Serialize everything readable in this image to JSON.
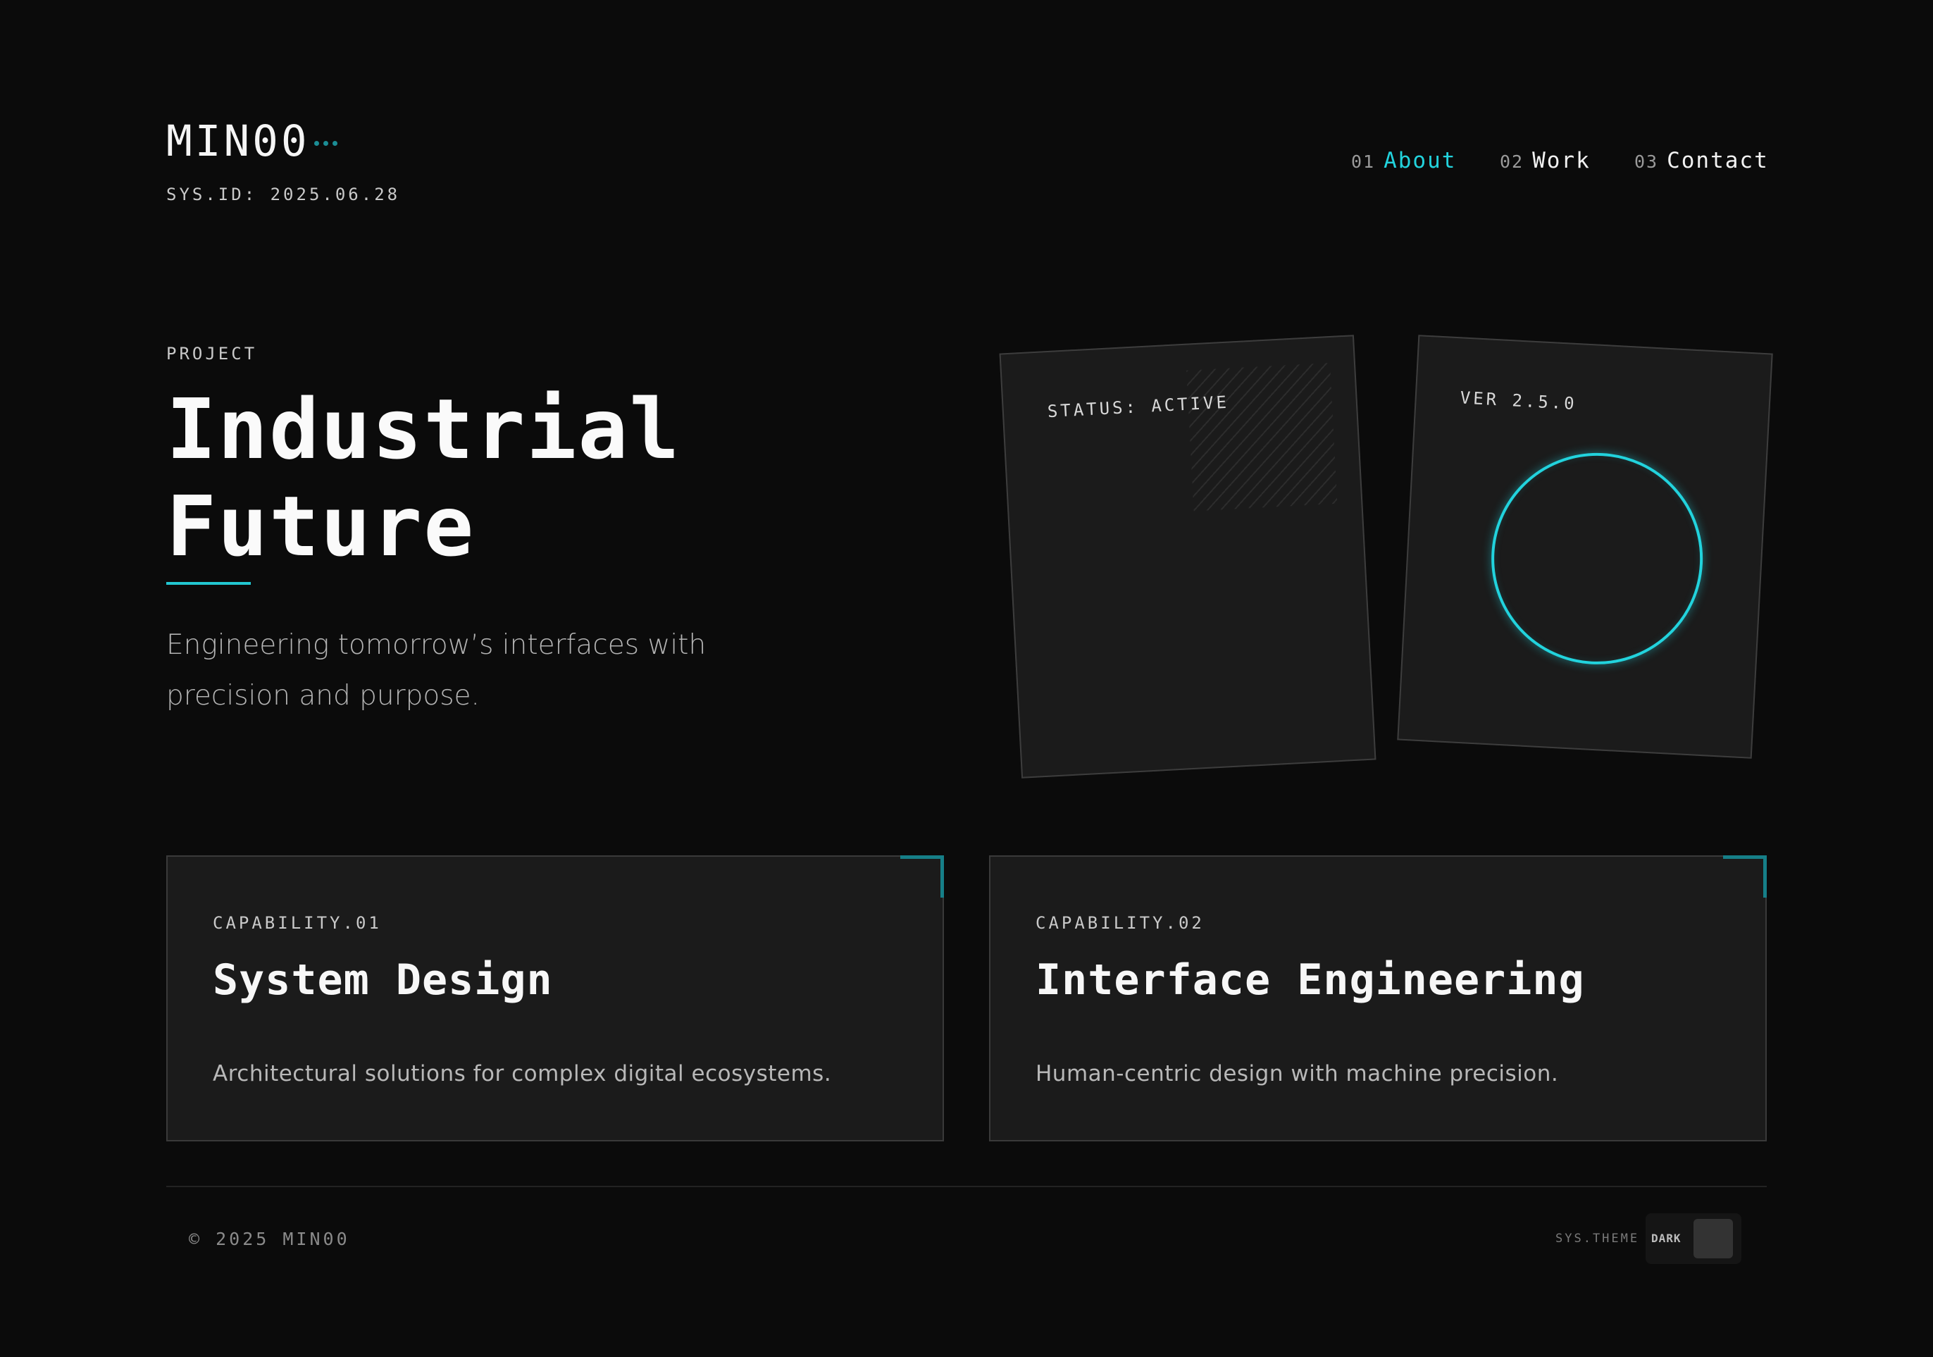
{
  "brand": {
    "logo": "MIN00",
    "sys_id": "SYS.ID: 2025.06.28"
  },
  "nav": [
    {
      "num": "01",
      "label": "About",
      "active": true
    },
    {
      "num": "02",
      "label": "Work",
      "active": false
    },
    {
      "num": "03",
      "label": "Contact",
      "active": false
    }
  ],
  "hero": {
    "eyebrow": "PROJECT",
    "title_line1": "Industrial",
    "title_line2": "Future",
    "subtitle_line1": "Engineering tomorrow’s interfaces with",
    "subtitle_line2": "precision and purpose."
  },
  "tiles": {
    "status_label": "STATUS: ACTIVE",
    "version_label": "VER 2.5.0"
  },
  "capabilities": [
    {
      "label": "CAPABILITY.01",
      "title": "System Design",
      "description": "Architectural solutions for complex digital ecosystems."
    },
    {
      "label": "CAPABILITY.02",
      "title": "Interface Engineering",
      "description": "Human-centric design with machine precision."
    }
  ],
  "footer": {
    "copyright": "© 2025 MIN00",
    "theme_label": "SYS.THEME",
    "theme_value": "DARK"
  },
  "colors": {
    "background": "#0b0b0b",
    "accent": "#22d3dd",
    "card": "#1b1b1b"
  },
  "icons": [
    "logo-dots-icon",
    "hatch-pattern",
    "ring-icon",
    "corner-bracket-icon"
  ]
}
